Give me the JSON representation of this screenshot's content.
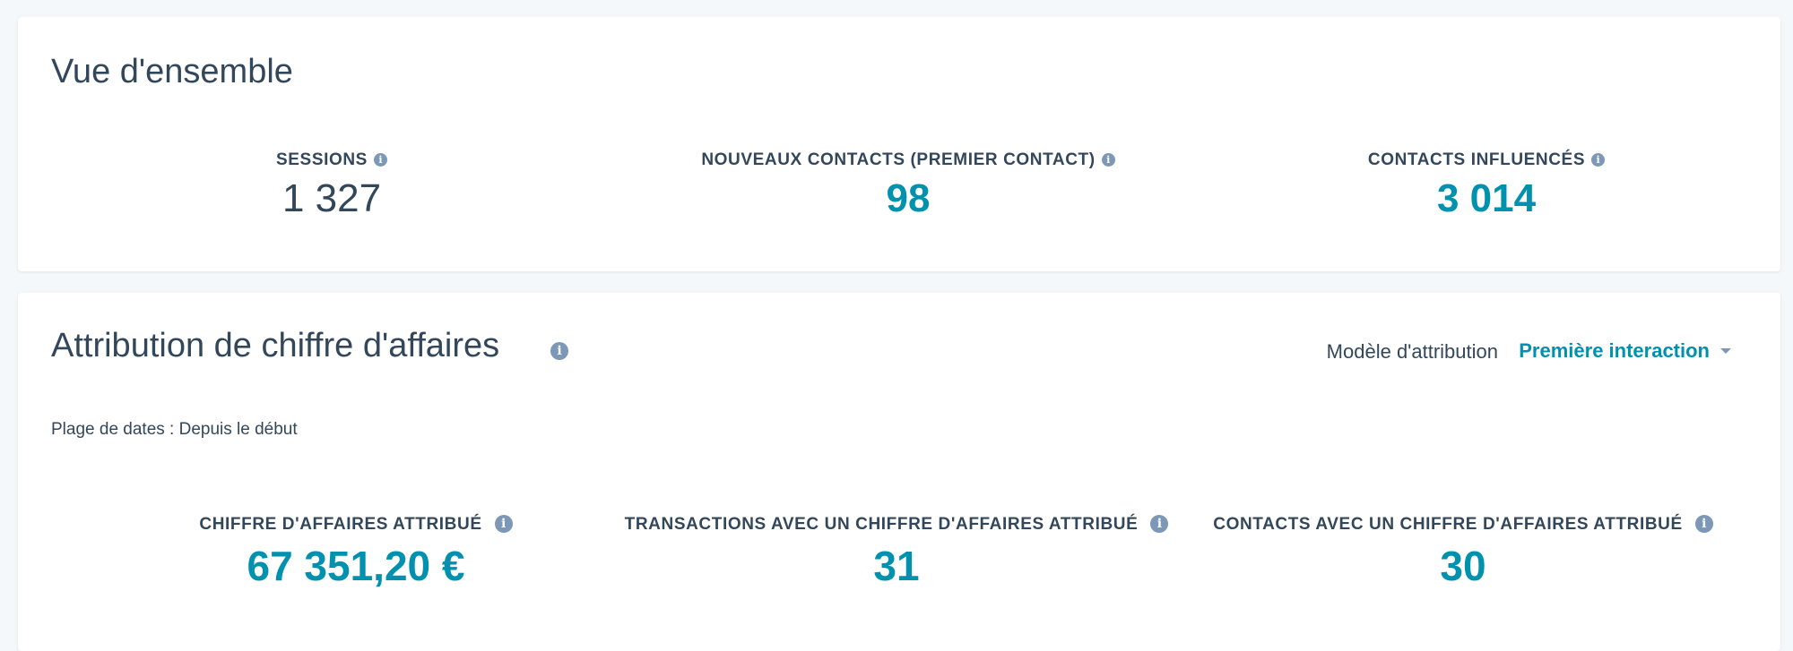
{
  "overview": {
    "title": "Vue d'ensemble",
    "kpis": {
      "sessions": {
        "label": "SESSIONS",
        "value": "1 327"
      },
      "new_contacts": {
        "label": "NOUVEAUX CONTACTS (PREMIER CONTACT)",
        "value": "98"
      },
      "influenced_contacts": {
        "label": "CONTACTS INFLUENCÉS",
        "value": "3 014"
      }
    }
  },
  "attribution": {
    "title": "Attribution de chiffre d'affaires",
    "model_label": "Modèle d'attribution",
    "model_value": "Première interaction",
    "date_range": "Plage de dates : Depuis le début",
    "kpis": {
      "attributed_revenue": {
        "label": "CHIFFRE D'AFFAIRES ATTRIBUÉ",
        "value": "67 351,20 €"
      },
      "deals_with_revenue": {
        "label": "TRANSACTIONS AVEC UN CHIFFRE D'AFFAIRES ATTRIBUÉ",
        "value": "31"
      },
      "contacts_with_revenue": {
        "label": "CONTACTS AVEC UN CHIFFRE D'AFFAIRES ATTRIBUÉ",
        "value": "30"
      }
    }
  },
  "icons": {
    "info_glyph": "i",
    "info": "info-icon",
    "dropdown": "caret-down-icon"
  },
  "colors": {
    "accent": "#0091ae",
    "text": "#33475b",
    "icon": "#7c98b6",
    "background": "#f5f8fa",
    "card": "#ffffff"
  }
}
